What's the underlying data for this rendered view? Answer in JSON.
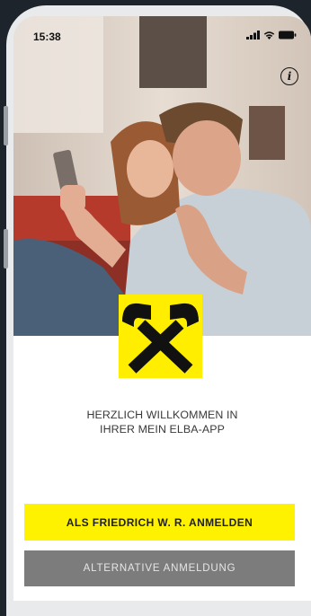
{
  "status_bar": {
    "time": "15:38"
  },
  "icons": {
    "info": "i"
  },
  "welcome": {
    "line1": "HERZLICH WILLKOMMEN IN",
    "line2": "IHRER MEIN ELBA-APP"
  },
  "buttons": {
    "primary_label": "ALS FRIEDRICH W. R. ANMELDEN",
    "secondary_label": "ALTERNATIVE ANMELDUNG"
  },
  "colors": {
    "brand_yellow": "#fff200",
    "secondary_gray": "#7c7c7c",
    "background": "#1d242b"
  }
}
